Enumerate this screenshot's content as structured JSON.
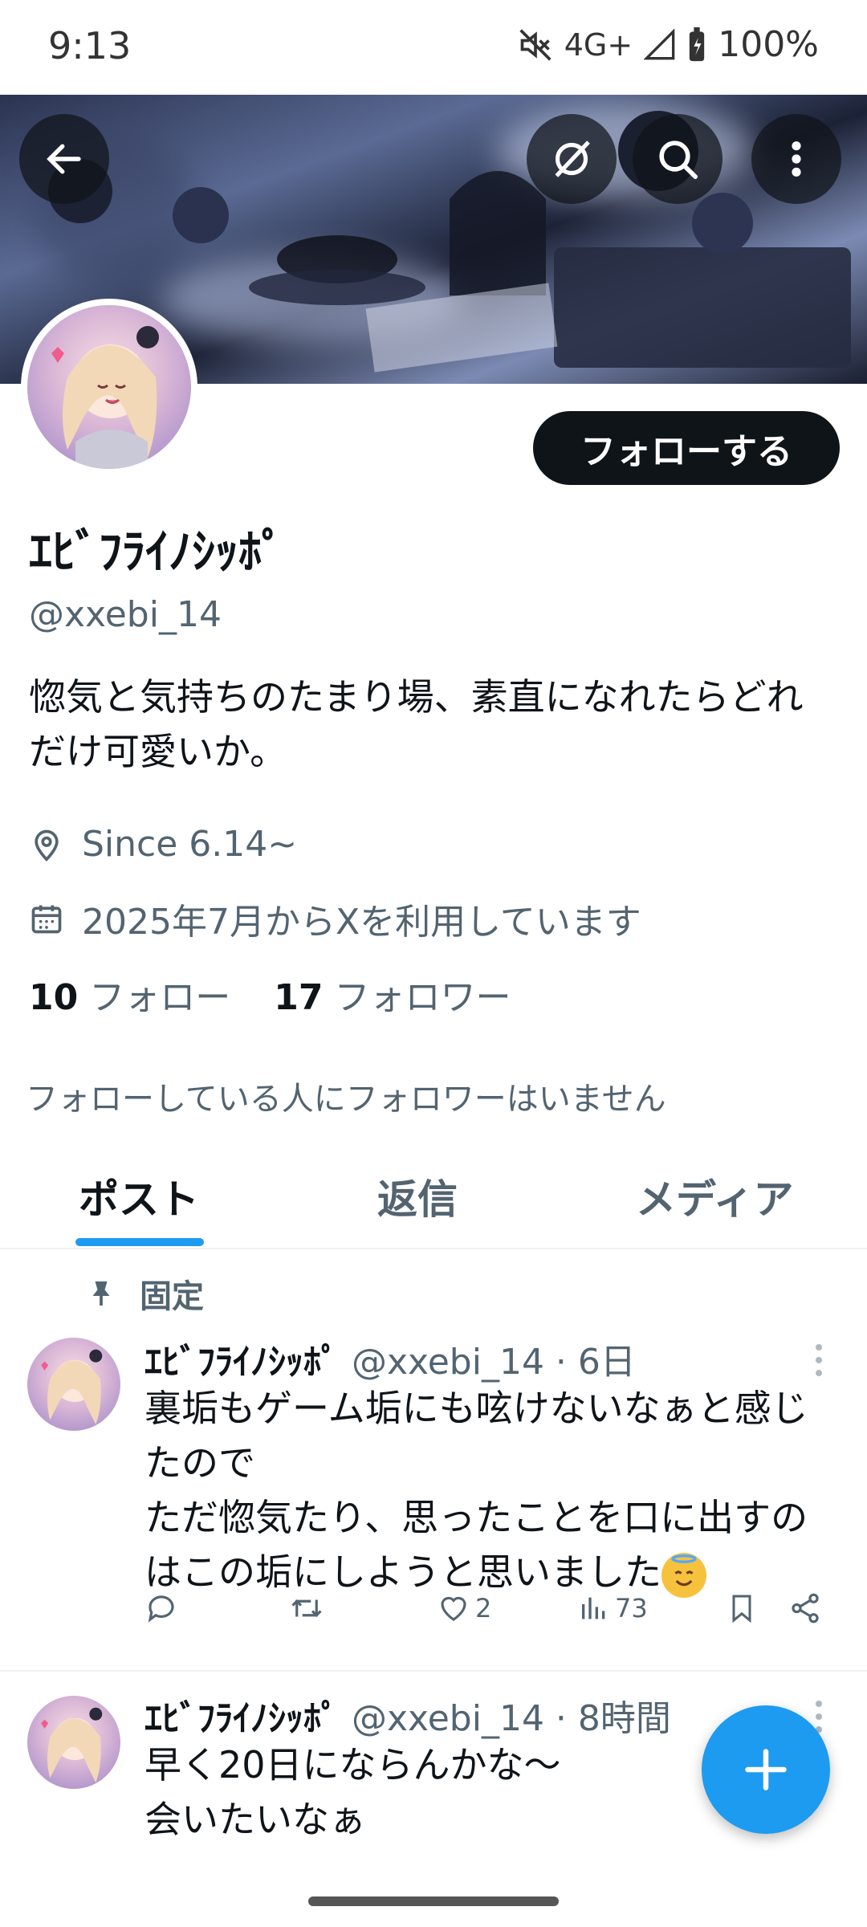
{
  "status_bar": {
    "time": "9:13",
    "network": "4G+",
    "battery": "100%"
  },
  "profile": {
    "display_name": "ｴﾋﾞﾌﾗｲﾉｼｯﾎﾟ",
    "handle": "@xxebi_14",
    "follow_label": "フォローする",
    "bio": "惚気と気持ちのたまり場、素直になれたらどれだけ可愛いか。",
    "location": "Since 6.14~",
    "joined": "2025年7月からXを利用しています",
    "following_count": "10",
    "following_label": "フォロー",
    "followers_count": "17",
    "followers_label": "フォロワー",
    "no_mutuals": "フォローしている人にフォロワーはいません"
  },
  "tabs": [
    "ポスト",
    "返信",
    "メディア"
  ],
  "pinned_label": "固定",
  "posts": [
    {
      "name": "ｴﾋﾞﾌﾗｲﾉｼｯﾎﾟ",
      "meta": "@xxebi_14 · 6日",
      "text_line1": "裏垢もゲーム垢にも呟けないなぁと感じたので",
      "text_line2": "ただ惚気たり、思ったことを口に出すのはこの垢にしようと思いました",
      "emoji": "smiling-face-with-halo",
      "likes": "2",
      "views": "73"
    },
    {
      "name": "ｴﾋﾞﾌﾗｲﾉｼｯﾎﾟ",
      "meta": "@xxebi_14 · 8時間",
      "text_line1": "早く20日にならんかな〜",
      "text_line2": "会いたいなぁ"
    }
  ],
  "colors": {
    "accent": "#1d9bf0",
    "text": "#0f1419",
    "muted": "#536471"
  }
}
